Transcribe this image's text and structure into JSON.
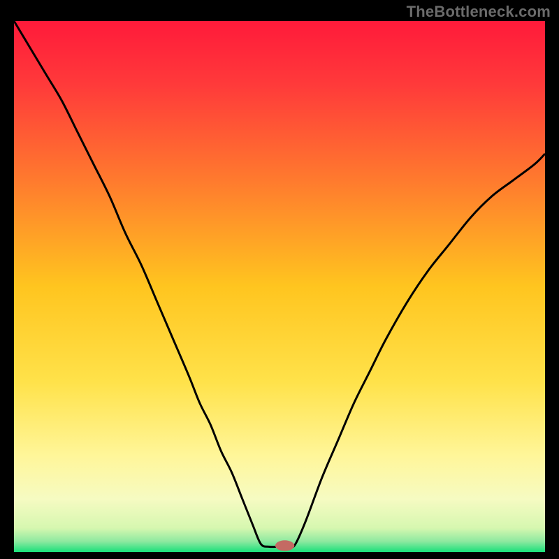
{
  "watermark": "TheBottleneck.com",
  "chart_data": {
    "type": "line",
    "title": "",
    "xlabel": "",
    "ylabel": "",
    "xlim": [
      0,
      100
    ],
    "ylim": [
      0,
      100
    ],
    "grid": false,
    "series": [
      {
        "name": "curve",
        "x": [
          0,
          3,
          6,
          9,
          12,
          15,
          18,
          21,
          24,
          27,
          30,
          33,
          35,
          37,
          39,
          41,
          43,
          45,
          46.5,
          48,
          50,
          52,
          53,
          55,
          58,
          61,
          64,
          67,
          70,
          74,
          78,
          82,
          86,
          90,
          94,
          98,
          100
        ],
        "y": [
          100,
          95,
          90,
          85,
          79,
          73,
          67,
          60,
          54,
          47,
          40,
          33,
          28,
          24,
          19,
          15,
          10,
          5,
          1.5,
          1,
          1,
          1,
          1.5,
          6,
          14,
          21,
          28,
          34,
          40,
          47,
          53,
          58,
          63,
          67,
          70,
          73,
          75
        ]
      }
    ],
    "marker": {
      "x": 51,
      "y": 1.2,
      "color": "#c46a63",
      "rx": 1.8,
      "ry": 1.0
    },
    "gradient_stops": [
      {
        "offset": 0.0,
        "color": "#ff1a3a"
      },
      {
        "offset": 0.12,
        "color": "#ff3a3a"
      },
      {
        "offset": 0.3,
        "color": "#ff7a2e"
      },
      {
        "offset": 0.5,
        "color": "#ffc51f"
      },
      {
        "offset": 0.68,
        "color": "#ffe24a"
      },
      {
        "offset": 0.82,
        "color": "#fff69a"
      },
      {
        "offset": 0.9,
        "color": "#f6fbc2"
      },
      {
        "offset": 0.955,
        "color": "#d6f7b0"
      },
      {
        "offset": 0.98,
        "color": "#8de9a0"
      },
      {
        "offset": 1.0,
        "color": "#19e07a"
      }
    ]
  }
}
